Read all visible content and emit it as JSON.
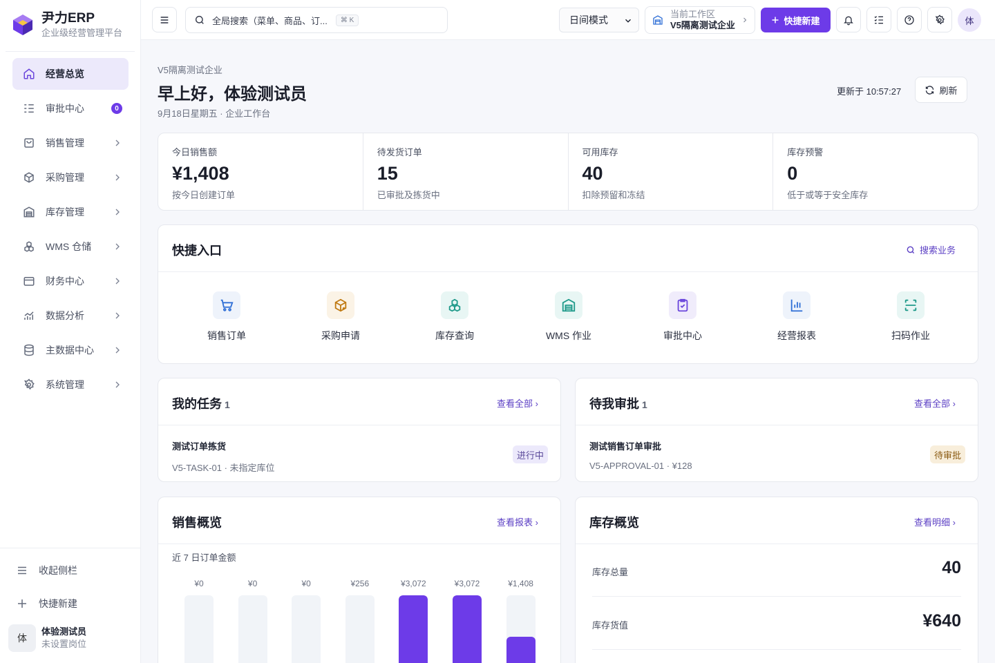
{
  "brand": {
    "name": "尹力ERP",
    "subtitle": "企业级经营管理平台"
  },
  "sidebar": {
    "items": [
      {
        "label": "经营总览",
        "icon": "home-icon",
        "active": true
      },
      {
        "label": "审批中心",
        "icon": "list-check-icon",
        "badge": "0"
      },
      {
        "label": "销售管理",
        "icon": "shopping-bag-icon"
      },
      {
        "label": "采购管理",
        "icon": "package-icon"
      },
      {
        "label": "库存管理",
        "icon": "warehouse-icon"
      },
      {
        "label": "WMS 仓储",
        "icon": "boxes-icon"
      },
      {
        "label": "财务中心",
        "icon": "wallet-icon"
      },
      {
        "label": "数据分析",
        "icon": "chart-icon"
      },
      {
        "label": "主数据中心",
        "icon": "database-icon"
      },
      {
        "label": "系统管理",
        "icon": "gear-icon"
      }
    ],
    "collapse_label": "收起侧栏",
    "quick_new_label": "快捷新建",
    "user": {
      "avatar": "体",
      "name": "体验测试员",
      "role": "未设置岗位"
    }
  },
  "header": {
    "search_placeholder": "全局搜索（菜单、商品、订...",
    "search_shortcut": "⌘ K",
    "mode": "日间模式",
    "workspace_label": "当前工作区",
    "workspace_value": "V5隔离测试企业",
    "quick_new": "快捷新建",
    "avatar": "体"
  },
  "page": {
    "breadcrumb": "V5隔离测试企业",
    "greeting": "早上好，体验测试员",
    "date_line": "9月18日星期五 · 企业工作台",
    "updated": "更新于 10:57:27",
    "refresh": "刷新"
  },
  "stats": [
    {
      "label": "今日销售额",
      "value": "¥1,408",
      "sub": "按今日创建订单"
    },
    {
      "label": "待发货订单",
      "value": "15",
      "sub": "已审批及拣货中"
    },
    {
      "label": "可用库存",
      "value": "40",
      "sub": "扣除预留和冻结"
    },
    {
      "label": "库存预警",
      "value": "0",
      "sub": "低于或等于安全库存"
    }
  ],
  "quick": {
    "title": "快捷入口",
    "search_link": "搜索业务",
    "items": [
      {
        "label": "销售订单",
        "icon": "cart-icon",
        "color": "#2f6fd6",
        "bg": "#eef3fb"
      },
      {
        "label": "采购申请",
        "icon": "box-plus-icon",
        "color": "#c07a12",
        "bg": "#fbf3e6"
      },
      {
        "label": "库存查询",
        "icon": "boxes-icon",
        "color": "#1f9a8a",
        "bg": "#e8f6f4"
      },
      {
        "label": "WMS 作业",
        "icon": "warehouse-icon",
        "color": "#1f9a8a",
        "bg": "#e8f6f4"
      },
      {
        "label": "审批中心",
        "icon": "clipboard-check-icon",
        "color": "#6b47dc",
        "bg": "#f0ecfb"
      },
      {
        "label": "经营报表",
        "icon": "bar-chart-icon",
        "color": "#2f6fd6",
        "bg": "#eef3fb"
      },
      {
        "label": "扫码作业",
        "icon": "scan-icon",
        "color": "#1f9a8a",
        "bg": "#e8f6f4"
      }
    ]
  },
  "tasks": {
    "title": "我的任务",
    "count": "1",
    "link": "查看全部 ›",
    "item": {
      "name": "测试订单拣货",
      "sub": "V5-TASK-01 · 未指定库位",
      "status": "进行中"
    }
  },
  "approvals": {
    "title": "待我审批",
    "count": "1",
    "link": "查看全部 ›",
    "item": {
      "name": "测试销售订单审批",
      "sub": "V5-APPROVAL-01 · ¥128",
      "status": "待审批"
    }
  },
  "sales": {
    "title": "销售概览",
    "link": "查看报表 ›",
    "subtitle": "近 7 日订单金额"
  },
  "chart_data": {
    "type": "bar",
    "values": [
      0,
      0,
      0,
      256,
      3072,
      3072,
      1408
    ],
    "value_labels": [
      "¥0",
      "¥0",
      "¥0",
      "¥256",
      "¥3,072",
      "¥3,072",
      "¥1,408"
    ],
    "ylim": [
      0,
      3072
    ],
    "color": "#6d3be8"
  },
  "inventory": {
    "title": "库存概览",
    "link": "查看明细 ›",
    "rows": [
      {
        "label": "库存总量",
        "value": "40"
      },
      {
        "label": "库存货值",
        "value": "¥640"
      }
    ]
  },
  "colors": {
    "accent": "#6d3be8",
    "accent_soft": "#ece9fb"
  }
}
